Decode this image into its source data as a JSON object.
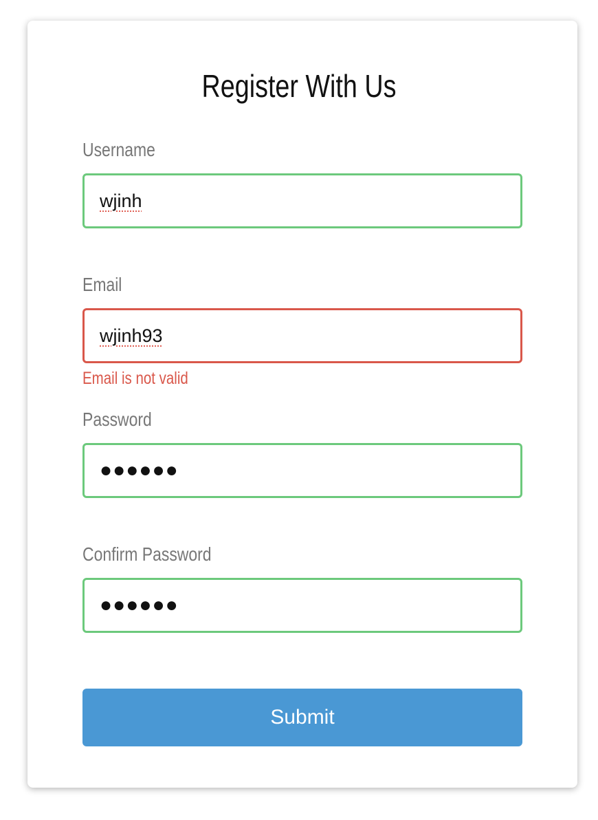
{
  "title": "Register With Us",
  "fields": [
    {
      "label": "Username",
      "value": "wjinh",
      "status": "valid"
    },
    {
      "label": "Email",
      "value": "wjinh93",
      "status": "invalid",
      "error": "Email is not valid"
    },
    {
      "label": "Password",
      "value": "●●●●●●",
      "status": "valid"
    },
    {
      "label": "Confirm Password",
      "value": "●●●●●●",
      "status": "valid"
    }
  ],
  "submit_label": "Submit",
  "colors": {
    "valid": "#6cc97c",
    "invalid": "#d9574a",
    "button": "#4a98d4"
  }
}
